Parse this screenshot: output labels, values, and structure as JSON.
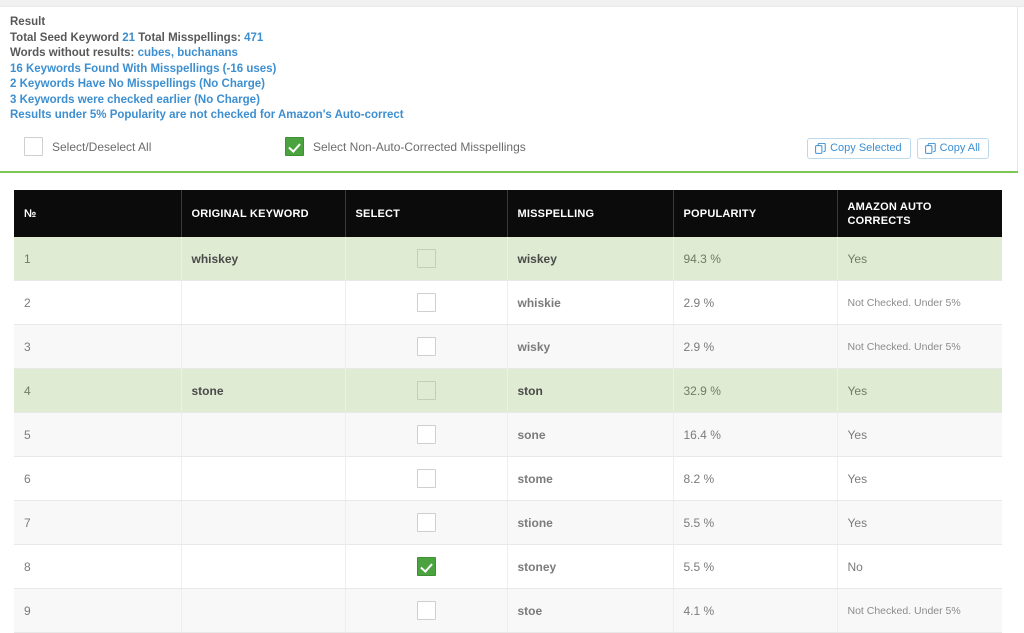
{
  "result": {
    "title": "Result",
    "summary_prefix": "Total Seed Keyword ",
    "seed_count": "21",
    "summary_mid": " Total Misspellings: ",
    "misspelling_count": "471",
    "words_without_label": "Words without results: ",
    "words_without_values": "cubes, buchanans",
    "found_line": "16 Keywords Found With Misspellings (-16 uses)",
    "no_misspellings_line": "2 Keywords Have No Misspellings (No Charge)",
    "checked_earlier_line": "3 Keywords were checked earlier (No Charge)",
    "under_five_line": "Results under 5% Popularity are not checked for Amazon's Auto-correct"
  },
  "controls": {
    "select_all_label": "Select/Deselect All",
    "select_all_checked": false,
    "select_nac_label": "Select Non-Auto-Corrected Misspellings",
    "select_nac_checked": true,
    "copy_selected_label": "Copy Selected",
    "copy_all_label": "Copy All",
    "copy_icon": "copy-icon"
  },
  "table": {
    "columns": [
      {
        "label": "№"
      },
      {
        "label": "ORIGINAL KEYWORD"
      },
      {
        "label": "SELECT"
      },
      {
        "label": "MISSPELLING"
      },
      {
        "label": "POPULARITY"
      },
      {
        "label": "AMAZON AUTO",
        "label2": "CORRECTS"
      }
    ],
    "rows": [
      {
        "num": "1",
        "keyword": "whiskey",
        "checked": false,
        "misspelling": "wiskey",
        "popularity": "94.3 %",
        "auto": "Yes",
        "auto_small": false,
        "style": "r-green"
      },
      {
        "num": "2",
        "keyword": "",
        "checked": false,
        "misspelling": "whiskie",
        "popularity": "2.9 %",
        "auto": "Not Checked. Under 5%",
        "auto_small": true,
        "style": "r-white"
      },
      {
        "num": "3",
        "keyword": "",
        "checked": false,
        "misspelling": "wisky",
        "popularity": "2.9 %",
        "auto": "Not Checked. Under 5%",
        "auto_small": true,
        "style": "r-alt"
      },
      {
        "num": "4",
        "keyword": "stone",
        "checked": false,
        "misspelling": "ston",
        "popularity": "32.9 %",
        "auto": "Yes",
        "auto_small": false,
        "style": "r-green"
      },
      {
        "num": "5",
        "keyword": "",
        "checked": false,
        "misspelling": "sone",
        "popularity": "16.4 %",
        "auto": "Yes",
        "auto_small": false,
        "style": "r-alt"
      },
      {
        "num": "6",
        "keyword": "",
        "checked": false,
        "misspelling": "stome",
        "popularity": "8.2 %",
        "auto": "Yes",
        "auto_small": false,
        "style": "r-white"
      },
      {
        "num": "7",
        "keyword": "",
        "checked": false,
        "misspelling": "stione",
        "popularity": "5.5 %",
        "auto": "Yes",
        "auto_small": false,
        "style": "r-alt"
      },
      {
        "num": "8",
        "keyword": "",
        "checked": true,
        "misspelling": "stoney",
        "popularity": "5.5 %",
        "auto": "No",
        "auto_small": false,
        "style": "r-white"
      },
      {
        "num": "9",
        "keyword": "",
        "checked": false,
        "misspelling": "stoe",
        "popularity": "4.1 %",
        "auto": "Not Checked. Under 5%",
        "auto_small": true,
        "style": "r-alt"
      }
    ]
  },
  "colors": {
    "link": "#3d8fd0",
    "accent_green": "#7dc855",
    "check_green": "#4ba33f",
    "row_green": "#dfebd2",
    "header_black": "#0b0b0b"
  }
}
